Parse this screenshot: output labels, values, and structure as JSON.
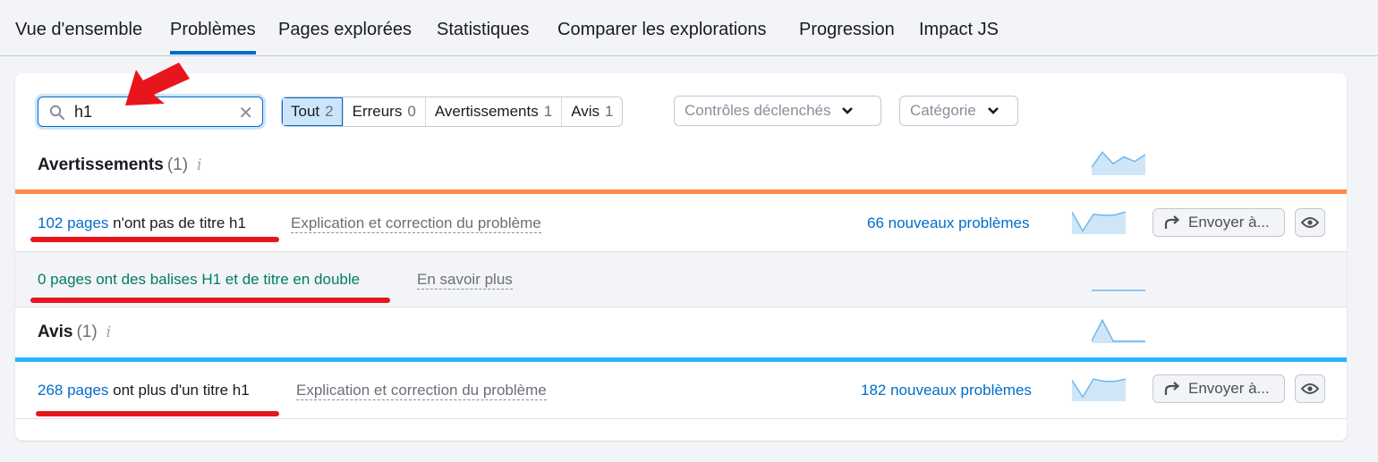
{
  "tabs": [
    {
      "label": "Vue d'ensemble",
      "active": false
    },
    {
      "label": "Problèmes",
      "active": true
    },
    {
      "label": "Pages explorées",
      "active": false
    },
    {
      "label": "Statistiques",
      "active": false
    },
    {
      "label": "Comparer les explorations",
      "active": false
    },
    {
      "label": "Progression",
      "active": false
    },
    {
      "label": "Impact JS",
      "active": false
    }
  ],
  "search": {
    "value": "h1",
    "icon": "search-icon",
    "clear_icon": "close-icon"
  },
  "filters": [
    {
      "label": "Tout",
      "count": "2",
      "active": true
    },
    {
      "label": "Erreurs",
      "count": "0",
      "active": false
    },
    {
      "label": "Avertissements",
      "count": "1",
      "active": false
    },
    {
      "label": "Avis",
      "count": "1",
      "active": false
    }
  ],
  "dropdowns": {
    "controls": {
      "label": "Contrôles déclenchés"
    },
    "category": {
      "label": "Catégorie"
    }
  },
  "sections": {
    "warnings": {
      "title": "Avertissements",
      "count": "(1)",
      "info": "i",
      "color": "#ff8c43",
      "trend": [
        0.3,
        0.95,
        0.45,
        0.75,
        0.55,
        0.85
      ]
    },
    "notices": {
      "title": "Avis",
      "count": "(1)",
      "info": "i",
      "color": "#2bb3ff",
      "trend": [
        0.05,
        0.95,
        0.05,
        0.05,
        0.05,
        0.05
      ]
    }
  },
  "issues": [
    {
      "count_link": "102 pages",
      "text": " n'ont pas de titre h1",
      "help": "Explication et correction du problème",
      "new_issues": "66 nouveaux problèmes",
      "send_label": "Envoyer à...",
      "trend": [
        0.95,
        0.1,
        0.85,
        0.8,
        0.82,
        0.95
      ]
    },
    {
      "text": "0 pages ont des balises H1 et de titre en double",
      "help": "En savoir plus",
      "trend": [
        0,
        0,
        0,
        0,
        0,
        0
      ]
    },
    {
      "count_link": "268 pages",
      "text": " ont plus d'un titre h1",
      "help": "Explication et correction du problème",
      "new_issues": "182 nouveaux problèmes",
      "send_label": "Envoyer à...",
      "trend": [
        0.9,
        0.15,
        0.95,
        0.85,
        0.85,
        0.95
      ]
    }
  ],
  "colors": {
    "accent": "#006dca",
    "warning": "#ff8c43",
    "notice": "#2bb3ff",
    "annotation": "#e8161c"
  }
}
